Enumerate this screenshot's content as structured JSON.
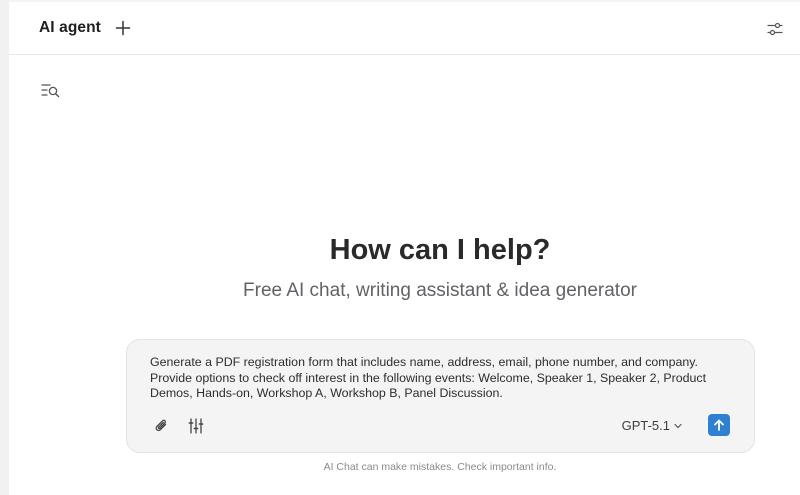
{
  "header": {
    "title": "AI agent",
    "new_chat_icon": "plus-icon",
    "settings_icon": "sliders-icon"
  },
  "sidebar": {
    "history_icon": "history-search-icon"
  },
  "hero": {
    "title": "How can I help?",
    "subtitle": "Free AI chat, writing assistant & idea generator"
  },
  "composer": {
    "prompt": "Generate a PDF registration form that includes name, address, email, phone number, and company. Provide options to check off interest in the following events: Welcome, Speaker 1, Speaker 2, Product Demos, Hands-on, Workshop A, Workshop B, Panel Discussion.",
    "attach_icon": "paperclip-icon",
    "tools_icon": "tune-icon",
    "model": "GPT-5.1",
    "send_icon": "arrow-up-icon"
  },
  "footer": {
    "disclaimer": "AI Chat can make mistakes. Check important info."
  },
  "colors": {
    "accent": "#2f80d1",
    "composer_bg": "#f4f4f5",
    "text_primary": "#2a2a2a",
    "text_muted": "#8a8a8a"
  }
}
